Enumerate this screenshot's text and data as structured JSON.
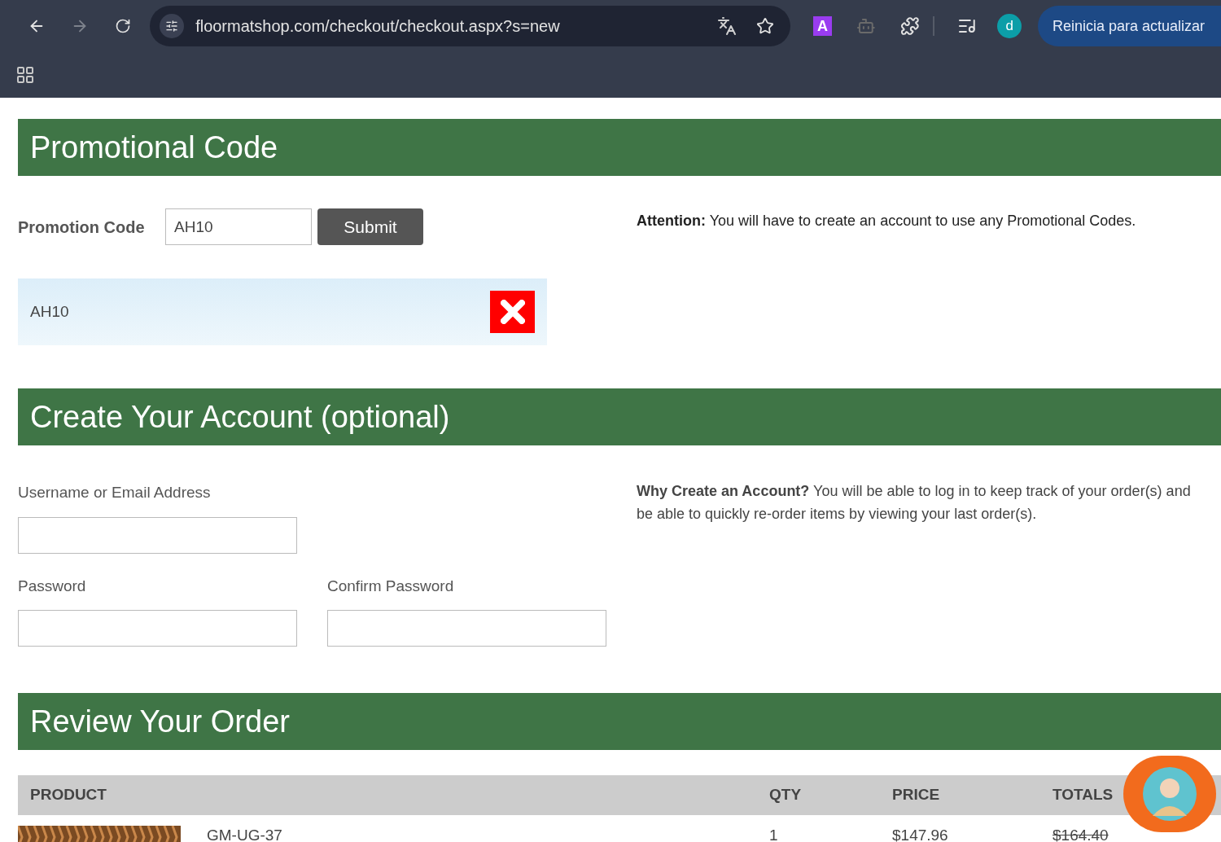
{
  "browser": {
    "nav_buttons": [
      {
        "kind": "back",
        "disabled": false
      },
      {
        "kind": "forward",
        "disabled": true
      },
      {
        "kind": "reload",
        "disabled": false
      }
    ],
    "url": "floormatshop.com/checkout/checkout.aspx?s=new",
    "extension_letter": "A",
    "profile_initial": "d",
    "update_button": "Reinicia para actualizar"
  },
  "promotional_code": {
    "title": "Promotional Code",
    "label": "Promotion Code",
    "value": "AH10",
    "submit": "Submit",
    "notice": "**Attention:** You will have to create an account to use any Promotional Codes.",
    "applied_code": "AH10"
  },
  "create_account": {
    "title": "Create Your Account (optional)",
    "fields": [
      {
        "label": "Username or Email Address"
      },
      {
        "label": "Password"
      },
      {
        "label": "Confirm Password"
      }
    ],
    "info": "**Why Create an Account?** You will be able to log in to keep track of your order(s) and be able to quickly re-order items by viewing your last order(s)."
  },
  "review_order": {
    "title": "Review Your Order",
    "columns": [
      "PRODUCT",
      "QTY",
      "PRICE",
      "TOTALS"
    ],
    "rows": [
      {
        "product": "GM-UG-37",
        "qty": "1",
        "price": "$147.96",
        "total": "$164.40",
        "total_struck": true
      }
    ]
  }
}
